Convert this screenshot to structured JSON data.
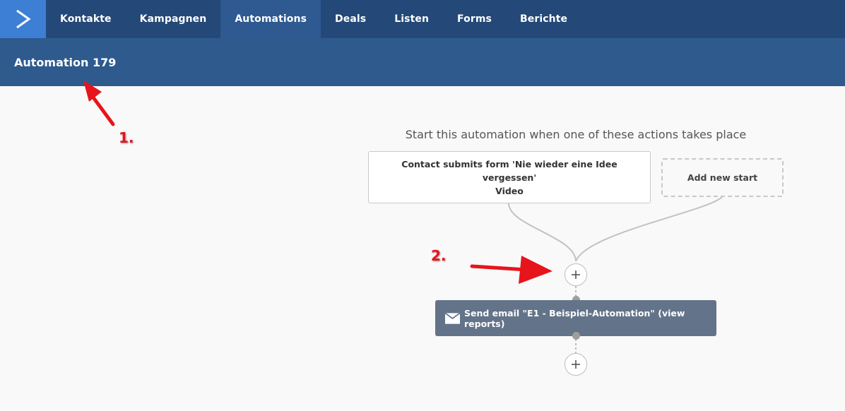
{
  "nav": {
    "items": [
      {
        "label": "Kontakte",
        "active": false
      },
      {
        "label": "Kampagnen",
        "active": false
      },
      {
        "label": "Automations",
        "active": true
      },
      {
        "label": "Deals",
        "active": false
      },
      {
        "label": "Listen",
        "active": false
      },
      {
        "label": "Forms",
        "active": false
      },
      {
        "label": "Berichte",
        "active": false
      }
    ]
  },
  "page": {
    "title": "Automation 179"
  },
  "builder": {
    "start_heading": "Start this automation when one of these actions takes place",
    "trigger": {
      "line1": "Contact submits form 'Nie wieder eine Idee vergessen'",
      "line2": "Video"
    },
    "add_start_label": "Add new start",
    "action_label": "Send email \"E1 - Beispiel-Automation\" (view reports)"
  },
  "annotations": {
    "marker1": "1.",
    "marker2": "2."
  },
  "colors": {
    "nav_bg": "#244877",
    "nav_active": "#2e5a91",
    "logo_bg": "#3d7fd4",
    "titlebar_bg": "#2e5a8e",
    "action_bg": "#637389",
    "annotation_red": "#e8141b"
  }
}
